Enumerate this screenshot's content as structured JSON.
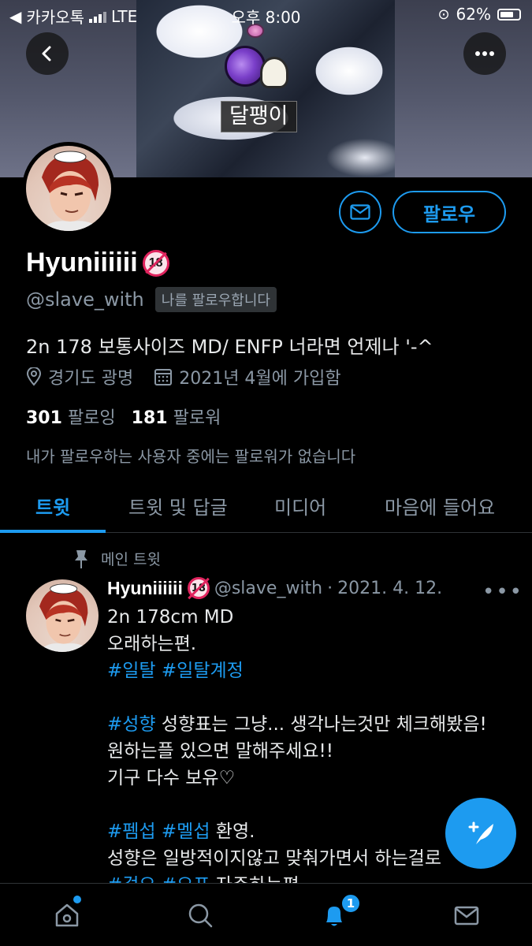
{
  "status_bar": {
    "carrier": "카카오톡",
    "network": "LTE",
    "time": "오후 8:00",
    "battery": "62%"
  },
  "banner": {
    "name_tag": "달팽이"
  },
  "profile": {
    "display_name": "Hyuniiiiii",
    "handle": "@slave_with",
    "follows_you": "나를 팔로우합니다",
    "follow_button": "팔로우",
    "bio": "2n 178 보통사이즈 MD/ ENFP 너라면 언제나 '-^",
    "location": "경기도 광명",
    "joined": "2021년 4월에 가입함",
    "following_count": "301",
    "following_label": "팔로잉",
    "followers_count": "181",
    "followers_label": "팔로워",
    "no_mutual_followers": "내가 팔로우하는 사용자 중에는 팔로워가 없습니다"
  },
  "tabs": [
    {
      "label": "트윗",
      "active": true
    },
    {
      "label": "트윗 및 답글",
      "active": false
    },
    {
      "label": "미디어",
      "active": false
    },
    {
      "label": "마음에 들어요",
      "active": false
    }
  ],
  "pinned_tweet": {
    "pinned_label": "메인 트윗",
    "name": "Hyuniiiiii",
    "handle": "@slave_with",
    "separator": "·",
    "date": "2021. 4. 12.",
    "lines": {
      "l1": "2n 178cm MD",
      "l2": "오래하는편.",
      "l3_tag1": "#일탈",
      "l3_tag2": "#일탈계정",
      "l4_tag": "#성향",
      "l4_text": " 성향표는 그냥... 생각나는것만 체크해봤음!",
      "l5": "원하는플 있으면 말해주세요!!",
      "l6": "기구 다수 보유♡",
      "l7_tag1": "#펨섭",
      "l7_tag2": "#멜섭",
      "l7_text": " 환영.",
      "l8": "성향은 일방적이지않고 맞춰가면서 하는걸로",
      "l9_tag1": "#걸오",
      "l9_tag2": "#오프",
      "l9_text": " 자주하는편"
    }
  },
  "bottom_nav": {
    "notification_count": "1"
  },
  "colors": {
    "accent": "#1d9bf0",
    "background": "#000000",
    "secondary_text": "#8b98a5"
  }
}
